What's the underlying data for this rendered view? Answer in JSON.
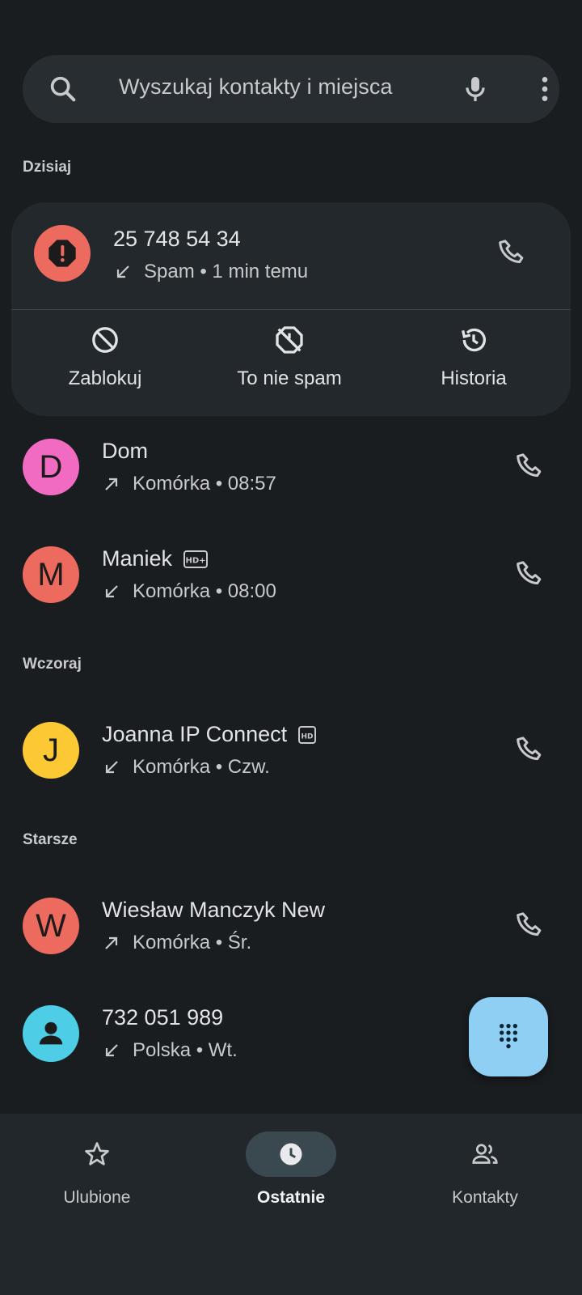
{
  "search": {
    "placeholder": "Wyszukaj kontakty i miejsca",
    "icons": [
      "search-icon",
      "microphone-icon",
      "more-vert-icon"
    ]
  },
  "sections": {
    "today": "Dzisiaj",
    "yesterday": "Wczoraj",
    "older": "Starsze"
  },
  "spam_card": {
    "number": "25 748 54 34",
    "subtitle": "Spam • 1 min temu",
    "direction": "incoming",
    "avatar_color": "#ec6a5e",
    "actions": [
      {
        "label": "Zablokuj",
        "icon": "block-icon"
      },
      {
        "label": "To nie spam",
        "icon": "not-spam-icon"
      },
      {
        "label": "Historia",
        "icon": "history-icon"
      }
    ]
  },
  "calls": [
    {
      "letter": "D",
      "name": "Dom",
      "subtitle": "Komórka • 08:57",
      "direction": "outgoing",
      "color": "#f16bc2",
      "hd": ""
    },
    {
      "letter": "M",
      "name": "Maniek",
      "subtitle": "Komórka • 08:00",
      "direction": "incoming",
      "color": "#ec6a5e",
      "hd": "HD+"
    },
    {
      "letter": "J",
      "name": "Joanna IP Connect",
      "subtitle": "Komórka • Czw.",
      "direction": "incoming",
      "color": "#fcc934",
      "hd": "HD"
    },
    {
      "letter": "W",
      "name": "Wiesław Manczyk New",
      "subtitle": "Komórka • Śr.",
      "direction": "outgoing",
      "color": "#ec6a5e",
      "hd": ""
    },
    {
      "letter": "",
      "name": "732 051 989",
      "subtitle": "Polska • Wt.",
      "direction": "incoming",
      "color": "#4ecde6",
      "hd": ""
    }
  ],
  "fab": {
    "icon": "dialpad-icon",
    "color": "#8ecff3"
  },
  "nav": [
    {
      "label": "Ulubione",
      "icon": "star-icon",
      "active": false
    },
    {
      "label": "Ostatnie",
      "icon": "clock-icon",
      "active": true
    },
    {
      "label": "Kontakty",
      "icon": "people-icon",
      "active": false
    }
  ]
}
